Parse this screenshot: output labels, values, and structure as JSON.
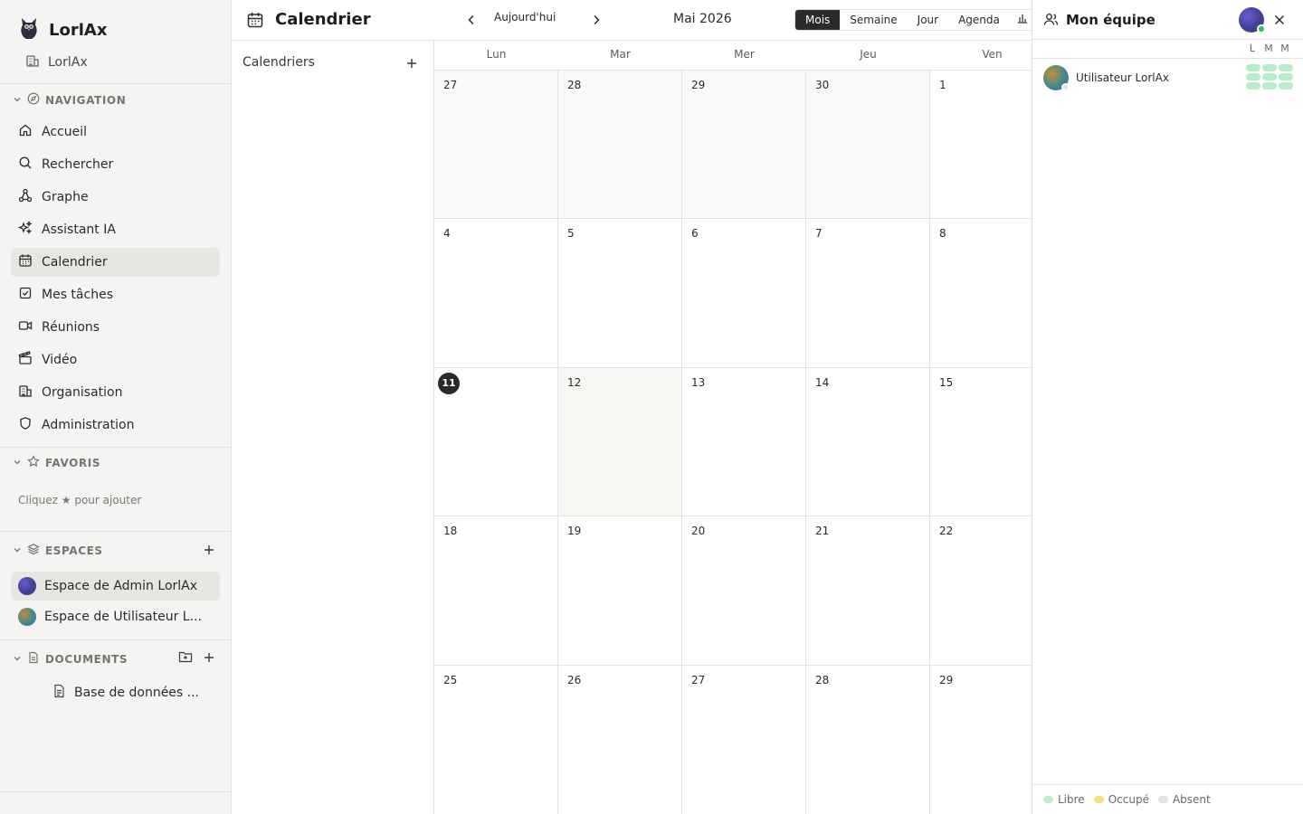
{
  "sidebar": {
    "brand": "LorlAx",
    "org": "LorlAx",
    "navigation": {
      "heading": "NAVIGATION",
      "items": [
        {
          "label": "Accueil",
          "icon": "home-icon"
        },
        {
          "label": "Rechercher",
          "icon": "search-icon"
        },
        {
          "label": "Graphe",
          "icon": "graph-icon"
        },
        {
          "label": "Assistant IA",
          "icon": "sparkles-icon"
        },
        {
          "label": "Calendrier",
          "icon": "calendar-icon",
          "active": true
        },
        {
          "label": "Mes tâches",
          "icon": "task-icon"
        },
        {
          "label": "Réunions",
          "icon": "video-icon"
        },
        {
          "label": "Vidéo",
          "icon": "clapper-icon"
        },
        {
          "label": "Organisation",
          "icon": "building-icon"
        },
        {
          "label": "Administration",
          "icon": "shield-icon"
        }
      ]
    },
    "favorites": {
      "heading": "FAVORIS",
      "hint": "Cliquez ★ pour ajouter"
    },
    "spaces": {
      "heading": "ESPACES",
      "items": [
        {
          "label": "Espace de Admin LorlAx",
          "active": true
        },
        {
          "label": "Espace de Utilisateur L..."
        }
      ]
    },
    "documents": {
      "heading": "DOCUMENTS",
      "items": [
        {
          "label": "Base de données ..."
        }
      ]
    }
  },
  "header": {
    "title": "Calendrier",
    "today": "Aujourd'hui",
    "month": "Mai 2026",
    "views": [
      "Mois",
      "Semaine",
      "Jour",
      "Agenda"
    ],
    "active_view": "Mois"
  },
  "calendars_panel": {
    "title": "Calendriers"
  },
  "calendar": {
    "weekdays": [
      "Lun",
      "Mar",
      "Mer",
      "Jeu",
      "Ven"
    ],
    "weeks": [
      [
        "27",
        "28",
        "29",
        "30",
        "1"
      ],
      [
        "4",
        "5",
        "6",
        "7",
        "8"
      ],
      [
        "11",
        "12",
        "13",
        "14",
        "15"
      ],
      [
        "18",
        "19",
        "20",
        "21",
        "22"
      ],
      [
        "25",
        "26",
        "27",
        "28",
        "29"
      ]
    ],
    "today": "11"
  },
  "team": {
    "title": "Mon équipe",
    "days": [
      "L",
      "M",
      "M"
    ],
    "members": [
      {
        "name": "Utilisateur LorlAx"
      }
    ],
    "legend": [
      {
        "label": "Libre",
        "color": "#bdeccb"
      },
      {
        "label": "Occupé",
        "color": "#f7e07a"
      },
      {
        "label": "Absent",
        "color": "#dfe3ea"
      }
    ]
  },
  "colors": {
    "accent": "#2b2a28",
    "online": "#22c55e",
    "free": "#b9ecc8"
  }
}
